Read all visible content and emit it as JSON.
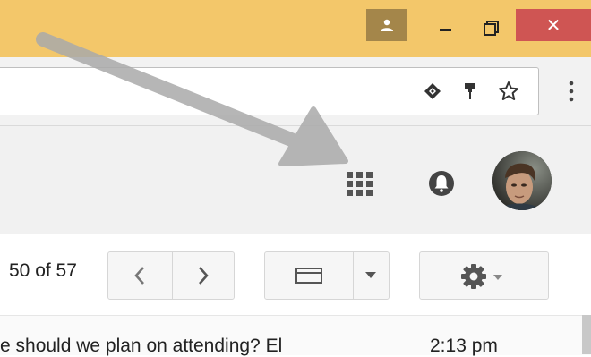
{
  "window": {
    "close_glyph": "✕",
    "accent_color": "#f3c76a",
    "close_color": "#cf5553"
  },
  "icons": {
    "profile": "person-icon",
    "minimize": "minimize-icon",
    "maximize": "maximize-icon",
    "close": "close-icon",
    "extension": "extension-icon",
    "bookmark_pin": "pin-icon",
    "bookmark_star": "star-icon",
    "chrome_menu": "more-vert-icon",
    "google_apps": "apps-grid-icon",
    "notifications": "bell-icon",
    "older": "chevron-left-icon",
    "newer": "chevron-right-icon",
    "density": "density-icon",
    "dropdown": "caret-down-icon",
    "settings": "gear-icon"
  },
  "mail": {
    "pagination": "50 of 57",
    "row": {
      "snippet": "e should we plan on attending? El",
      "time": "2:13 pm"
    }
  }
}
